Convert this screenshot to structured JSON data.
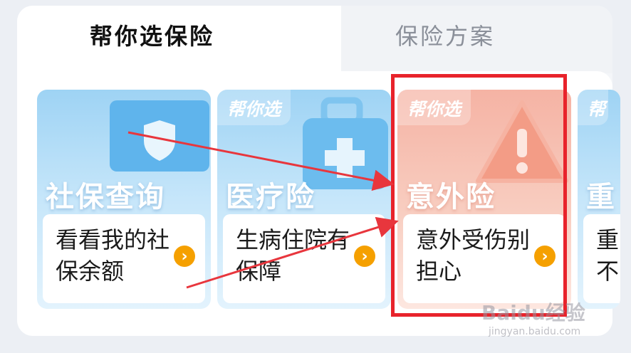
{
  "tabs": {
    "active_label": "帮你选保险",
    "inactive_label": "保险方案"
  },
  "cards": [
    {
      "tag": "",
      "title": "社保查询",
      "desc": "看看我的社保余额",
      "icon": "shield-icon"
    },
    {
      "tag": "帮你选",
      "title": "医疗险",
      "desc": "生病住院有保障",
      "icon": "medical-kit-icon"
    },
    {
      "tag": "帮你选",
      "title": "意外险",
      "desc": "意外受伤别担心",
      "icon": "warning-icon"
    },
    {
      "tag": "帮",
      "title": "重",
      "desc": "重不",
      "icon": ""
    }
  ],
  "arrow_icon": "chevron-right-icon",
  "watermark": {
    "logo": "Baidu经验",
    "url": "jingyan.baidu.com"
  },
  "colors": {
    "highlight": "#e8232b",
    "arrow": "#e8363d",
    "button": "#f5a000",
    "card_blue": "#9ed3f4",
    "card_red": "#f5b3a4"
  }
}
